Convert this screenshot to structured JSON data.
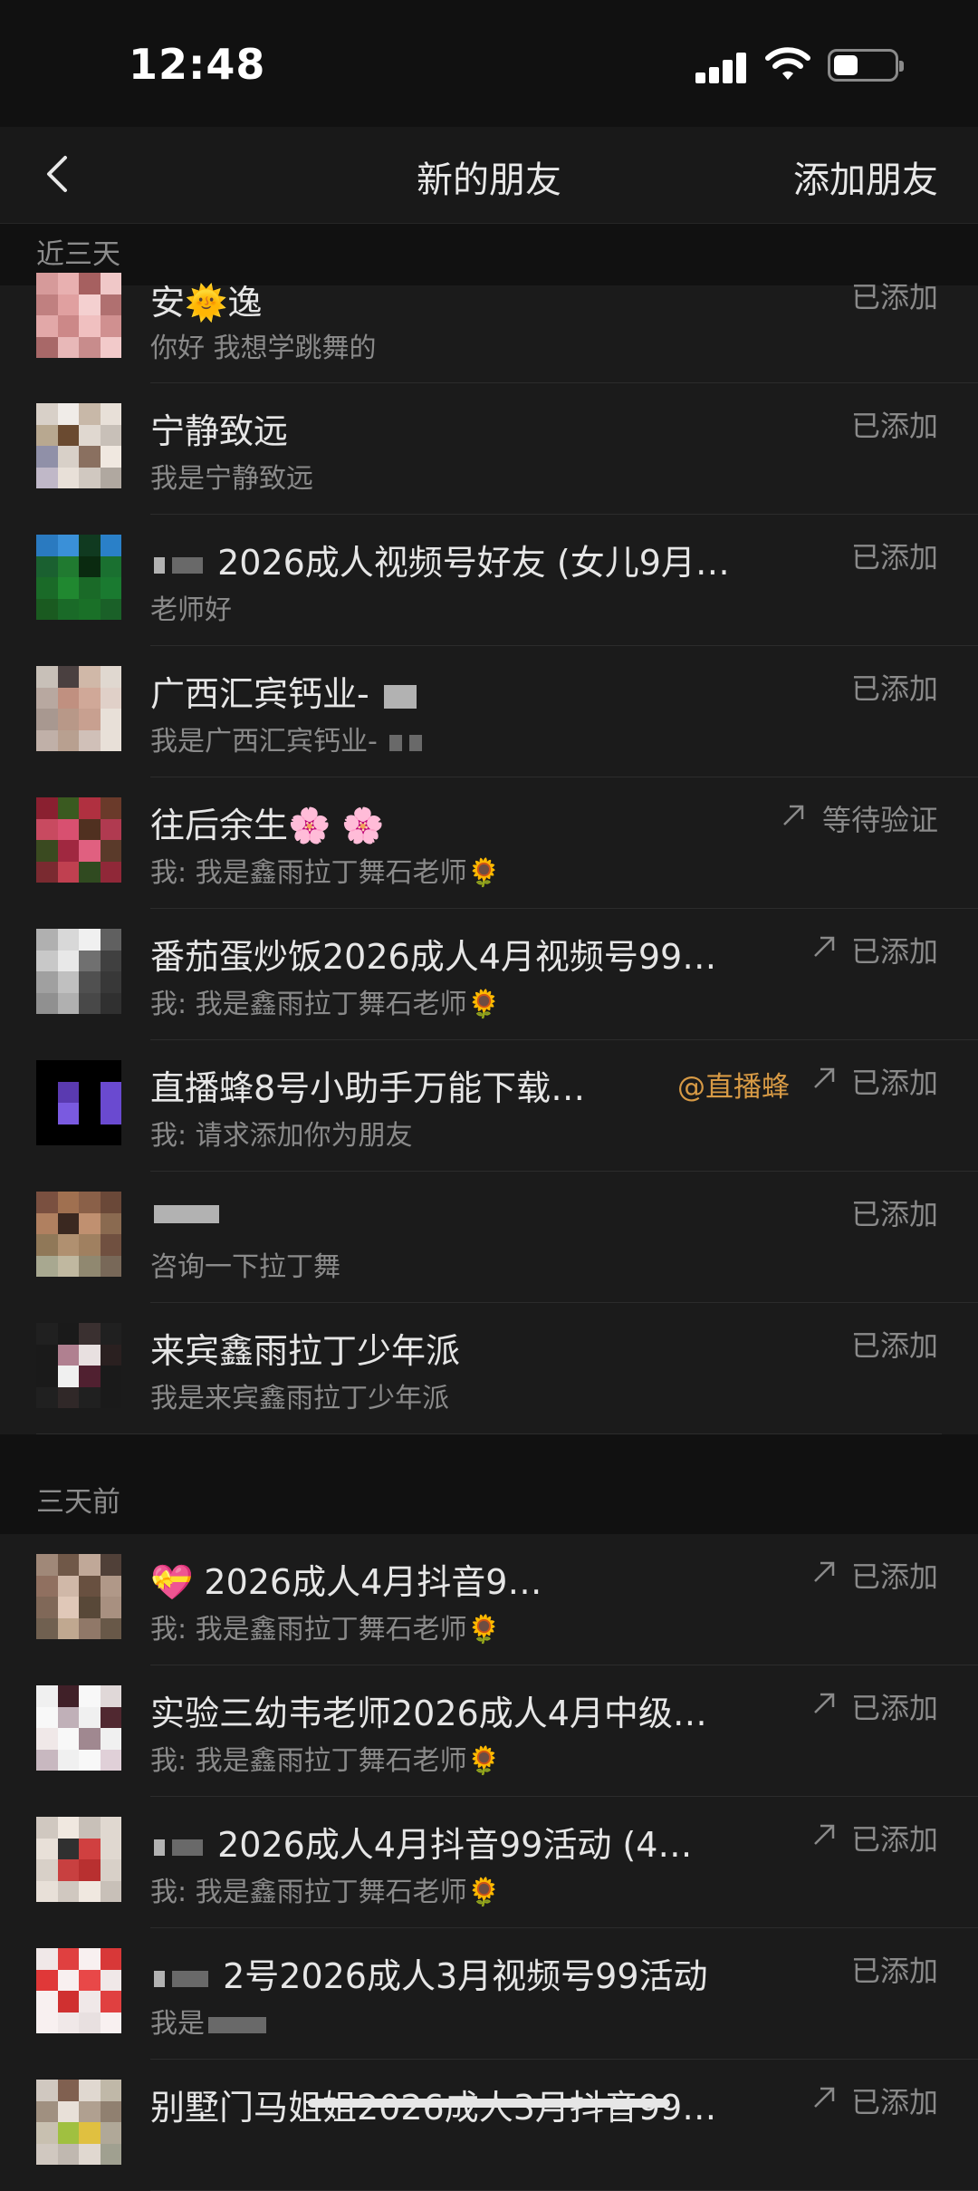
{
  "status_bar": {
    "time": "12:48"
  },
  "nav": {
    "title": "新的朋友",
    "action": "添加朋友"
  },
  "sections": {
    "recent": "近三天",
    "earlier": "三天前"
  },
  "rows": [
    {
      "name": "安🌞逸",
      "sub": "你好  我想学跳舞的",
      "state": "已添加",
      "arrow": false
    },
    {
      "name": "宁静致远",
      "sub": "我是宁静致远",
      "state": "已添加",
      "arrow": false
    },
    {
      "name": "2026成人视频号好友 (女儿9月…",
      "sub": "老师好",
      "state": "已添加",
      "arrow": false
    },
    {
      "name": "广西汇宾钙业-",
      "sub": "我是广西汇宾钙业-",
      "state": "已添加",
      "arrow": false
    },
    {
      "name": "往后余生🌸 🌸",
      "sub": "我: 我是鑫雨拉丁舞石老师🌻",
      "state": "等待验证",
      "arrow": true
    },
    {
      "name": "番茄蛋炒饭2026成人4月视频号99…",
      "sub": "我: 我是鑫雨拉丁舞石老师🌻",
      "state": "已添加",
      "arrow": true
    },
    {
      "name": "直播蜂8号小助手万能下载…",
      "tag": "@直播蜂",
      "sub": "我: 请求添加你为朋友",
      "state": "已添加",
      "arrow": true
    },
    {
      "name": "",
      "sub": "咨询一下拉丁舞",
      "state": "已添加",
      "arrow": false
    },
    {
      "name": "来宾鑫雨拉丁少年派",
      "sub": "我是来宾鑫雨拉丁少年派",
      "state": "已添加",
      "arrow": false
    },
    {
      "name": "💝 2026成人4月抖音9…",
      "sub": "我: 我是鑫雨拉丁舞石老师🌻",
      "state": "已添加",
      "arrow": true
    },
    {
      "name": "实验三幼韦老师2026成人4月中级…",
      "sub": "我: 我是鑫雨拉丁舞石老师🌻",
      "state": "已添加",
      "arrow": true
    },
    {
      "name": "2026成人4月抖音99活动 (4…",
      "sub": "我: 我是鑫雨拉丁舞石老师🌻",
      "state": "已添加",
      "arrow": true
    },
    {
      "name": "2号2026成人3月视频号99活动",
      "sub": "我是",
      "state": "已添加",
      "arrow": false
    },
    {
      "name": "别墅门马姐姐2026成人3月抖音99…",
      "sub": "",
      "state": "已添加",
      "arrow": true
    }
  ],
  "colors": {
    "accent_tag": "#d79a45",
    "background": "#111111",
    "row": "#1b1b1b"
  }
}
